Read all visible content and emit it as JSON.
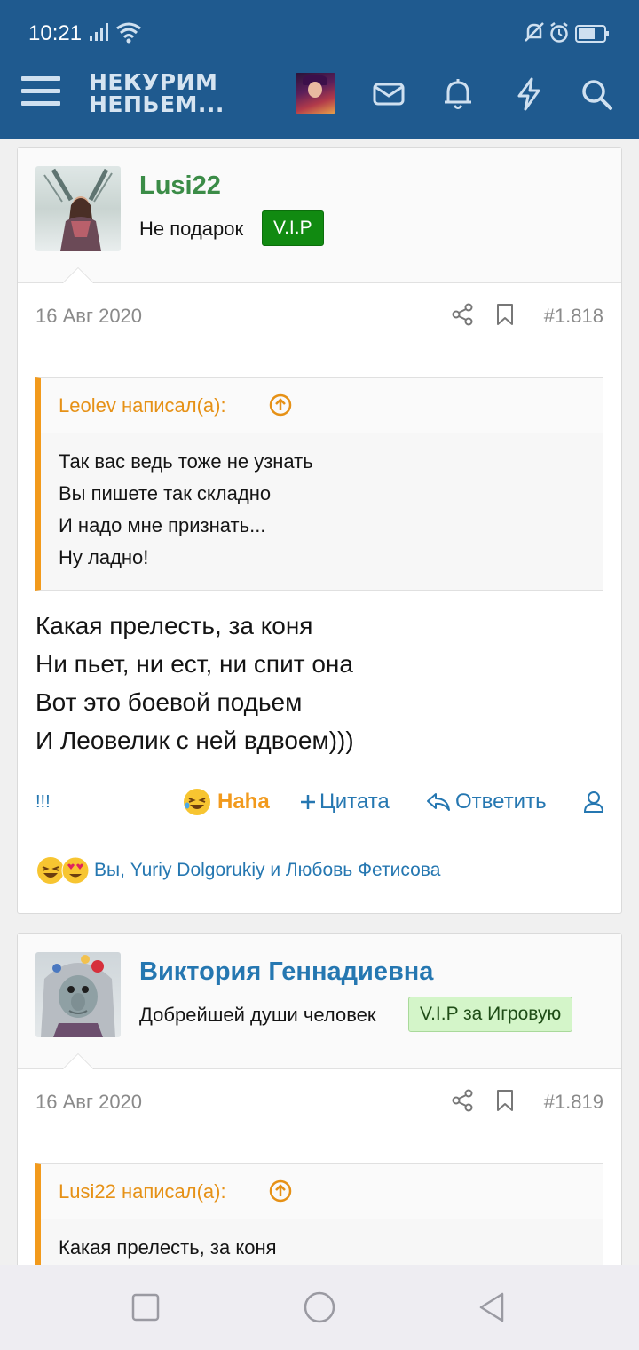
{
  "status_bar": {
    "time": "10:21",
    "icons": [
      "signal-icon",
      "wifi-icon",
      "bell-off-icon",
      "alarm-icon",
      "battery-icon"
    ]
  },
  "header": {
    "logo_line1": "НЕКУРИМ",
    "logo_line2": "НЕПЬЕМ...",
    "icons": [
      "menu-icon",
      "avatar",
      "mail-icon",
      "bell-icon",
      "lightning-icon",
      "search-icon"
    ]
  },
  "colors": {
    "header_bg": "#1f5a8f",
    "link": "#2577b1",
    "quote_accent": "#f29a1c",
    "user1_name": "#3b8c47",
    "user2_name": "#2577b1",
    "vip_badge": "#118a11",
    "vip_game_badge": "#d4f5c9"
  },
  "posts": [
    {
      "username": "Lusi22",
      "user_title": "Не подарок",
      "badge": "V.I.P",
      "date": "16 Авг 2020",
      "post_number": "#1.818",
      "quote": {
        "author": "Leolev написал(а):",
        "lines": [
          "Так вас ведь тоже не узнать",
          "Вы пишете так складно",
          "И надо мне признать...",
          "Ну ладно!"
        ]
      },
      "message": [
        "Какая прелесть, за коня",
        "Ни пьет, ни ест, ни спит она",
        "Вот это боевой подьем",
        "И Леовелик с ней вдвоем)))"
      ],
      "actions": {
        "report": "!!!",
        "reaction": "Haha",
        "quote": "Цитата",
        "reply": "Ответить"
      },
      "reactions_text": "Вы, Yuriy Dolgorukiy и Любовь Фетисова"
    },
    {
      "username": "Виктория Геннадиевна",
      "user_title": "Добрейшей души человек",
      "badge": "V.I.P за Игровую",
      "date": "16 Авг 2020",
      "post_number": "#1.819",
      "quote": {
        "author": "Lusi22 написал(а):",
        "lines": [
          "Какая прелесть, за коня"
        ]
      }
    }
  ],
  "nav_bar": {
    "icons": [
      "recent-apps-icon",
      "home-icon",
      "back-icon"
    ]
  }
}
